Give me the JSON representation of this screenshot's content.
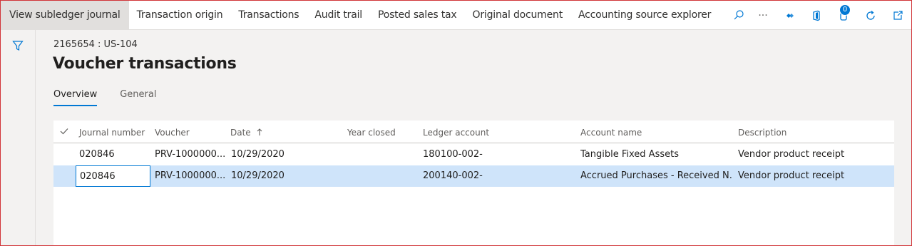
{
  "actionbar": {
    "items": [
      {
        "label": "View subledger journal"
      },
      {
        "label": "Transaction origin"
      },
      {
        "label": "Transactions"
      },
      {
        "label": "Audit trail"
      },
      {
        "label": "Posted sales tax"
      },
      {
        "label": "Original document"
      },
      {
        "label": "Accounting source explorer"
      }
    ],
    "more_label": "···",
    "notification_count": "0"
  },
  "header": {
    "caption": "2165654 : US-104",
    "title": "Voucher transactions"
  },
  "tabs": [
    {
      "label": "Overview"
    },
    {
      "label": "General"
    }
  ],
  "grid": {
    "columns": {
      "journal_number": "Journal number",
      "voucher": "Voucher",
      "date": "Date",
      "year_closed": "Year closed",
      "ledger_account": "Ledger account",
      "account_name": "Account name",
      "description": "Description"
    },
    "rows": [
      {
        "journal_number": "020846",
        "voucher": "PRV-1000000...",
        "date": "10/29/2020",
        "year_closed": "",
        "ledger_account": "180100-002-",
        "account_name": "Tangible Fixed Assets",
        "description": "Vendor product receipt"
      },
      {
        "journal_number": "020846",
        "voucher": "PRV-1000000...",
        "date": "10/29/2020",
        "year_closed": "",
        "ledger_account": "200140-002-",
        "account_name": "Accrued Purchases - Received N...",
        "description": "Vendor product receipt"
      }
    ]
  }
}
